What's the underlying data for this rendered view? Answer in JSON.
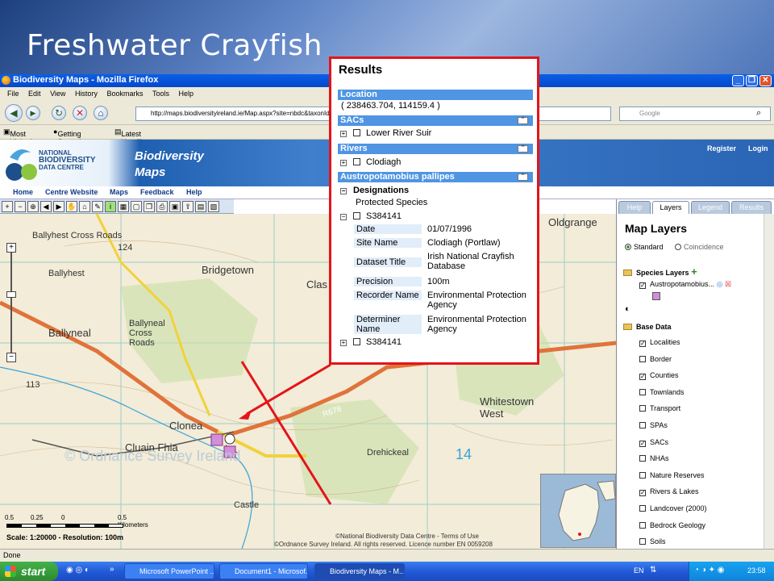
{
  "slide": {
    "title": "Freshwater Crayfish"
  },
  "browser": {
    "window_title": "Biodiversity Maps - Mozilla Firefox",
    "menu": [
      "File",
      "Edit",
      "View",
      "History",
      "Bookmarks",
      "Tools",
      "Help"
    ],
    "url": "http://maps.biodiversityireland.ie/Map.aspx?site=nbdc&taxonId=",
    "search_placeholder": "Google",
    "bookmarks": [
      "Most Visited",
      "Getting Started",
      "Latest Headlines"
    ],
    "status": "Done"
  },
  "site": {
    "logo_line1": "NATIONAL",
    "logo_line2": "BIODIVERSITY",
    "logo_line3": "DATA CENTRE",
    "app_title_1": "Biodiversity",
    "app_title_2": "Maps",
    "register": "Register",
    "login": "Login",
    "nav": [
      "Home",
      "Centre Website",
      "Maps",
      "Feedback",
      "Help"
    ]
  },
  "map": {
    "labels": [
      "Ballyhest Cross Roads",
      "Ballyhest",
      "Bridgetown",
      "Ballyneal Cross Roads",
      "Ballyneal",
      "Clonea",
      "Cluain Fhia",
      "Whitestown West",
      "Drehickeal",
      "Castle",
      "Oldgrange",
      "124",
      "113",
      "R678",
      "14",
      "Clas"
    ],
    "scale_ticks": [
      "0.5",
      "0.25",
      "0",
      "0.5 Kilometers"
    ],
    "scale_text": "Scale: 1:20000 - Resolution: 100m",
    "copyright_1": "©National Biodiversity Data Centre - Terms of Use",
    "copyright_2": "©Ordnance Survey Ireland. All rights reserved. Licence number EN 0059208",
    "watermark": "© Ordnance Survey Ireland"
  },
  "panel": {
    "tabs": [
      "Help",
      "Layers",
      "Legend",
      "Results"
    ],
    "active_tab": "Layers",
    "title": "Map Layers",
    "mode_standard": "Standard",
    "mode_coincidence": "Coincidence",
    "species_layers": "Species Layers",
    "species_item": "Austropotamobius...",
    "base_data": "Base Data",
    "base_layers": [
      {
        "label": "Localities",
        "checked": true
      },
      {
        "label": "Border",
        "checked": false
      },
      {
        "label": "Counties",
        "checked": true
      },
      {
        "label": "Townlands",
        "checked": false
      },
      {
        "label": "Transport",
        "checked": false
      },
      {
        "label": "SPAs",
        "checked": false
      },
      {
        "label": "SACs",
        "checked": true
      },
      {
        "label": "NHAs",
        "checked": false
      },
      {
        "label": "Nature Reserves",
        "checked": false
      },
      {
        "label": "Rivers & Lakes",
        "checked": true
      },
      {
        "label": "Landcover (2000)",
        "checked": false
      },
      {
        "label": "Bedrock Geology",
        "checked": false
      },
      {
        "label": "Soils",
        "checked": false
      }
    ]
  },
  "results": {
    "title": "Results",
    "location_header": "Location",
    "location_value": "( 238463.704, 114159.4 )",
    "sacs_header": "SACs",
    "sac_item": "Lower River Suir",
    "rivers_header": "Rivers",
    "river_item": "Clodiagh",
    "species_header": "Austropotamobius pallipes",
    "designations": "Designations",
    "designation_value": "Protected Species",
    "record_id": "S384141",
    "record_id_2": "S384141",
    "details": [
      {
        "key": "Date",
        "value": "01/07/1996"
      },
      {
        "key": "Site Name",
        "value": "Clodiagh (Portlaw)"
      },
      {
        "key": "Dataset Title",
        "value": "Irish National Crayfish Database"
      },
      {
        "key": "Precision",
        "value": "100m"
      },
      {
        "key": "Recorder Name",
        "value": "Environmental Protection Agency"
      },
      {
        "key": "Determiner Name",
        "value": "Environmental Protection Agency"
      }
    ]
  },
  "taskbar": {
    "start": "start",
    "tasks": [
      "Microsoft PowerPoint ...",
      "Document1 - Microsof...",
      "Biodiversity Maps - M..."
    ],
    "lang": "EN",
    "clock": "23:58"
  },
  "colors": {
    "accent": "#4f95e3",
    "popup_border": "#e4141a",
    "road": "#e0733a"
  }
}
